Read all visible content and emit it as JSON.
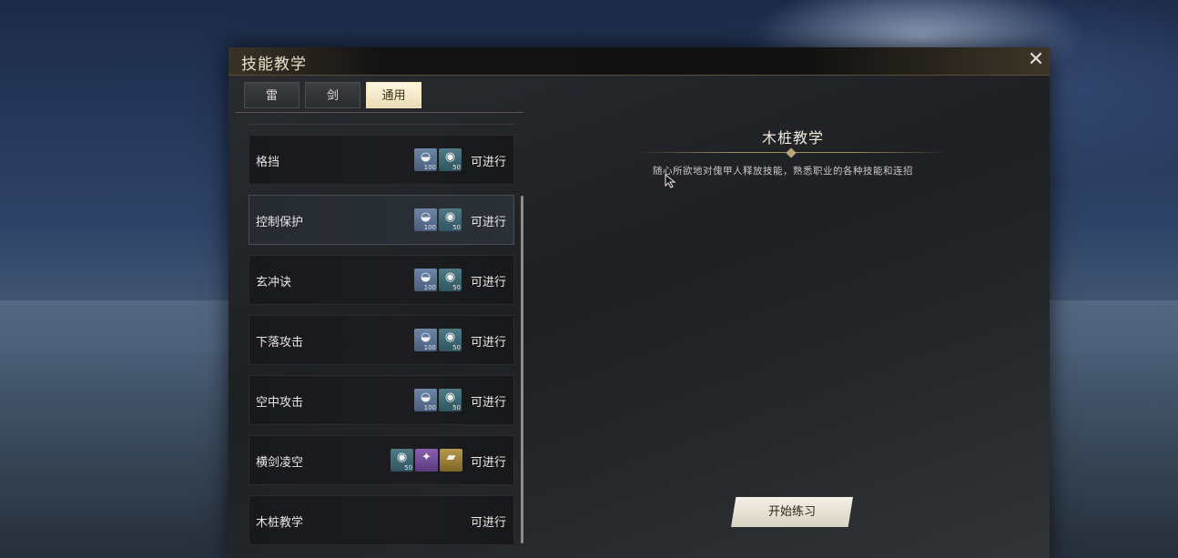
{
  "window": {
    "title": "技能教学",
    "close_icon": "close-icon"
  },
  "tabs": [
    {
      "label": "雷",
      "active": false
    },
    {
      "label": "剑",
      "active": false
    },
    {
      "label": "通用",
      "active": true
    }
  ],
  "skills": [
    {
      "name": "格挡",
      "status": "可进行",
      "selected": false,
      "costs": [
        {
          "icon": "silver-ingot-icon",
          "count": "100"
        },
        {
          "icon": "jade-coin-icon",
          "count": "50"
        }
      ]
    },
    {
      "name": "控制保护",
      "status": "可进行",
      "selected": true,
      "costs": [
        {
          "icon": "silver-ingot-icon",
          "count": "100"
        },
        {
          "icon": "jade-coin-icon",
          "count": "50"
        }
      ]
    },
    {
      "name": "玄冲诀",
      "status": "可进行",
      "selected": false,
      "costs": [
        {
          "icon": "silver-ingot-icon",
          "count": "100"
        },
        {
          "icon": "jade-coin-icon",
          "count": "50"
        }
      ]
    },
    {
      "name": "下落攻击",
      "status": "可进行",
      "selected": false,
      "costs": [
        {
          "icon": "silver-ingot-icon",
          "count": "100"
        },
        {
          "icon": "jade-coin-icon",
          "count": "50"
        }
      ]
    },
    {
      "name": "空中攻击",
      "status": "可进行",
      "selected": false,
      "costs": [
        {
          "icon": "silver-ingot-icon",
          "count": "100"
        },
        {
          "icon": "jade-coin-icon",
          "count": "50"
        }
      ]
    },
    {
      "name": "横剑凌空",
      "status": "可进行",
      "selected": false,
      "costs": [
        {
          "icon": "jade-coin-icon",
          "count": "50"
        },
        {
          "icon": "purple-item-icon",
          "count": ""
        },
        {
          "icon": "gold-item-icon",
          "count": ""
        }
      ]
    },
    {
      "name": "木桩教学",
      "status": "可进行",
      "selected": false,
      "costs": []
    }
  ],
  "detail": {
    "title": "木桩教学",
    "description": "随心所欲地对傀甲人释放技能，熟悉职业的各种技能和连招",
    "start_button": "开始练习"
  },
  "colors": {
    "accent_gold": "#a08c60",
    "tab_active_bg": "#eadcb6"
  }
}
